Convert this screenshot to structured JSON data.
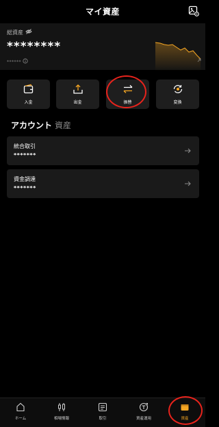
{
  "header": {
    "title": "マイ資産",
    "right_icon": "image-settings-icon"
  },
  "total": {
    "label": "総資産",
    "value": "********",
    "sub_value": "******",
    "accent": "#f5a623"
  },
  "actions": [
    {
      "label": "入金",
      "icon": "deposit-icon"
    },
    {
      "label": "出金",
      "icon": "withdraw-icon"
    },
    {
      "label": "振替",
      "icon": "transfer-icon",
      "highlighted": true
    },
    {
      "label": "変換",
      "icon": "convert-icon"
    }
  ],
  "tabs": [
    {
      "label": "アカウント",
      "active": true
    },
    {
      "label": "資産",
      "active": false
    }
  ],
  "accounts": [
    {
      "name": "統合取引",
      "value": "*******"
    },
    {
      "name": "資金調達",
      "value": "*******"
    }
  ],
  "nav": [
    {
      "label": "ホーム",
      "icon": "home-icon"
    },
    {
      "label": "相場情報",
      "icon": "candlestick-icon"
    },
    {
      "label": "取引",
      "icon": "trade-icon"
    },
    {
      "label": "資産運用",
      "icon": "earn-icon"
    },
    {
      "label": "資産",
      "icon": "wallet-icon",
      "active": true
    }
  ],
  "colors": {
    "highlight_ring": "#e8231c",
    "accent": "#f5a623",
    "background": "#000000"
  }
}
